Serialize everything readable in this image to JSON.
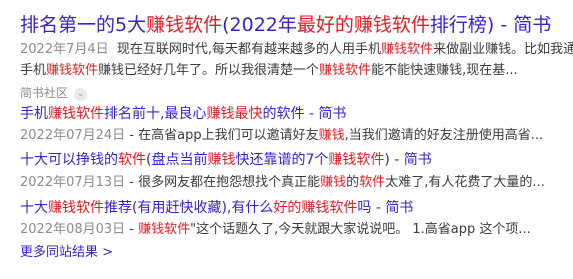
{
  "main": {
    "title": [
      "排名第一的5大",
      "赚钱软件",
      "(2022年",
      "最好的",
      "赚钱软件",
      "排行榜) - 简书"
    ],
    "snippet_date": "2022年7月4日",
    "snippet1": [
      "现在互联网时代,每天都有越来越多的人用手机",
      "赚钱软件",
      "来做副业赚钱。比如我通过"
    ],
    "snippet2": [
      "手机",
      "赚钱软件",
      "赚钱已经好几年了。所以我很清楚一个",
      "赚钱软件",
      "能不能快速赚钱,现在基..."
    ]
  },
  "site": {
    "name": "简书社区",
    "chevron": "⌄"
  },
  "sub": [
    {
      "title": [
        "手机",
        "赚钱软件",
        "排名前十,最良心",
        "赚钱最快",
        "的软件 - 简书"
      ],
      "date": "2022年07月24日",
      "snippet": [
        " - 在高省app上我们可以邀请好友",
        "赚钱",
        ",当我们邀请的好友注册使用高省..."
      ]
    },
    {
      "title": [
        "十大可以挣钱的",
        "软件",
        "(盘点当前",
        "赚钱",
        "快还靠谱的7个",
        "赚钱软件",
        ") - 简书"
      ],
      "date": "2022年07月13日",
      "snippet": [
        " - 很多网友都在抱怨想找个真正能",
        "赚钱",
        "的",
        "软件",
        "太难了,有人花费了大量的..."
      ]
    },
    {
      "title": [
        "十大",
        "赚钱软件",
        "推荐(有用赶快收藏),有什么",
        "好的赚钱软件",
        "吗 - 简书"
      ],
      "date": "2022年08月03日",
      "snippet": [
        " - ",
        "赚钱软件",
        "\"这个话题久了,今天就跟大家说说吧。 1.高省app 这个项..."
      ]
    }
  ],
  "more": "更多同站结果 >"
}
